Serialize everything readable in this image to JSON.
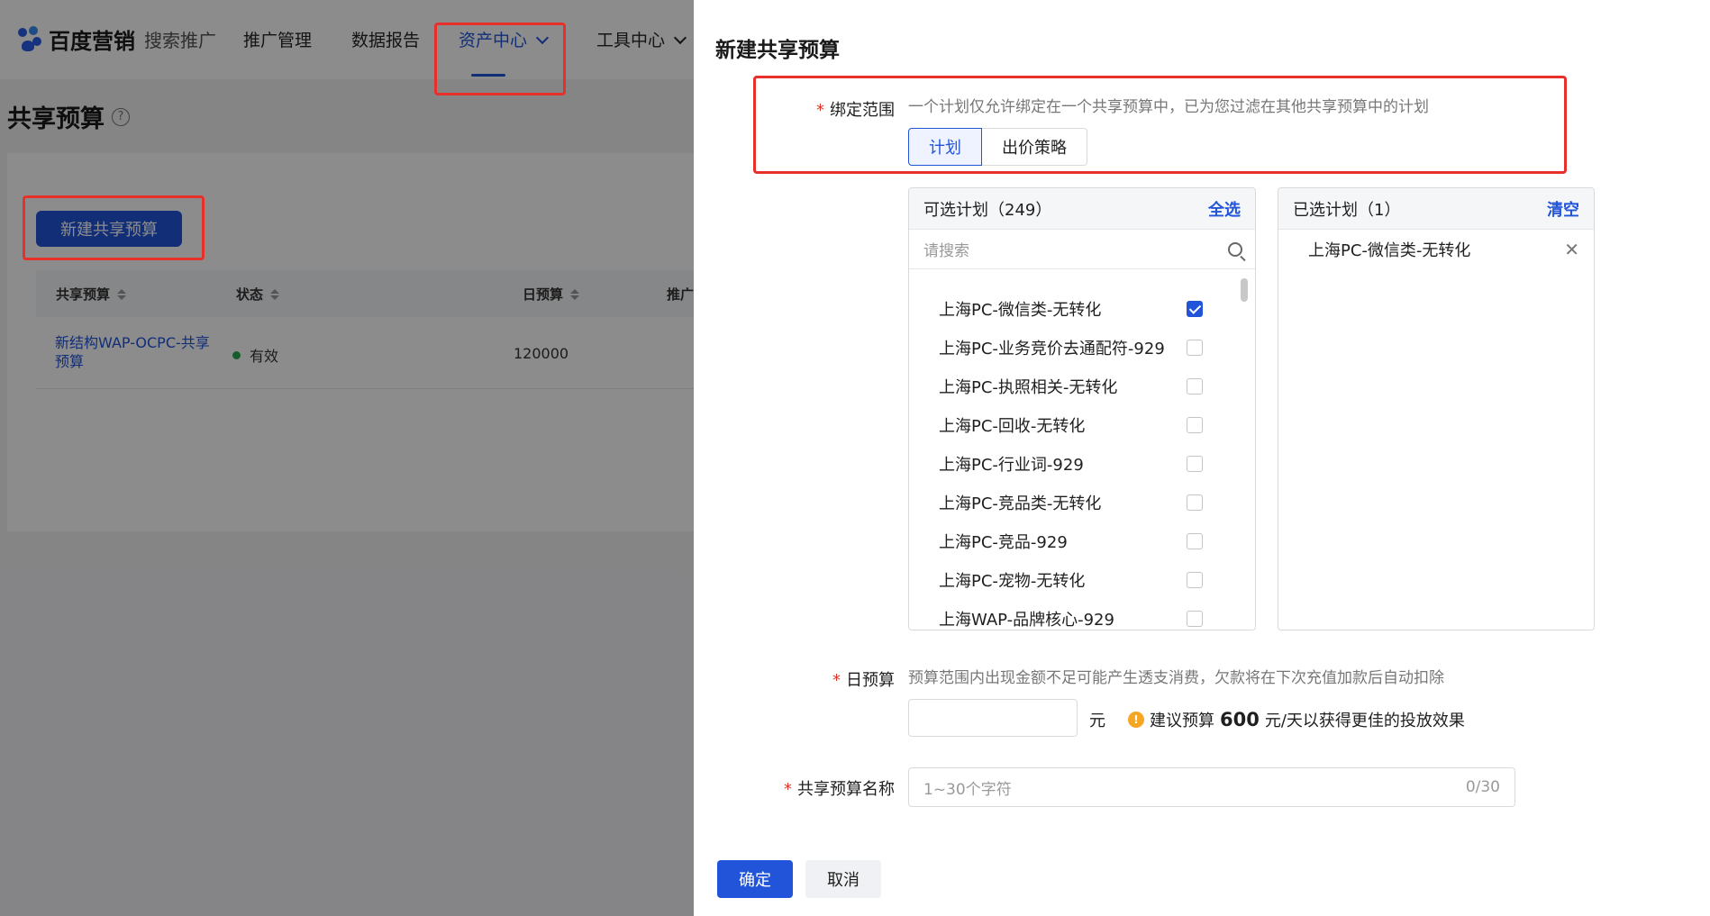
{
  "nav": {
    "brand": "百度营销",
    "brand_sub": "搜索推广",
    "items": [
      "推广管理",
      "数据报告",
      "资产中心",
      "工具中心"
    ]
  },
  "page": {
    "title": "共享预算",
    "new_button": "新建共享预算",
    "columns": [
      "共享预算",
      "状态",
      "日预算",
      "推广"
    ],
    "rows": [
      {
        "name": "新结构WAP-OCPC-共享预算",
        "status": "有效",
        "budget": "120000"
      }
    ]
  },
  "drawer": {
    "title": "新建共享预算",
    "scope": {
      "label": "绑定范围",
      "hint": "一个计划仅允许绑定在一个共享预算中，已为您过滤在其他共享预算中的计划",
      "tabs": [
        "计划",
        "出价策略"
      ]
    },
    "available": {
      "title": "可选计划（249）",
      "action": "全选",
      "search_placeholder": "请搜索",
      "items": [
        {
          "label": "上海PC-微信类-无转化",
          "checked": true
        },
        {
          "label": "上海PC-业务竞价去通配符-929",
          "checked": false
        },
        {
          "label": "上海PC-执照相关-无转化",
          "checked": false
        },
        {
          "label": "上海PC-回收-无转化",
          "checked": false
        },
        {
          "label": "上海PC-行业词-929",
          "checked": false
        },
        {
          "label": "上海PC-竞品类-无转化",
          "checked": false
        },
        {
          "label": "上海PC-竞品-929",
          "checked": false
        },
        {
          "label": "上海PC-宠物-无转化",
          "checked": false
        },
        {
          "label": "上海WAP-品牌核心-929",
          "checked": false
        }
      ]
    },
    "selected": {
      "title": "已选计划（1）",
      "action": "清空",
      "items": [
        "上海PC-微信类-无转化"
      ]
    },
    "daily_budget": {
      "label": "日预算",
      "hint": "预算范围内出现金额不足可能产生透支消费，欠款将在下次充值加款后自动扣除",
      "value": "",
      "unit": "元",
      "suggest_prefix": "建议预算",
      "suggest_amount": "600",
      "suggest_suffix": "元/天以获得更佳的投放效果"
    },
    "name_field": {
      "label": "共享预算名称",
      "placeholder": "1~30个字符",
      "counter": "0/30"
    },
    "confirm": "确定",
    "cancel": "取消"
  },
  "colors": {
    "primary": "#2154d9",
    "highlight": "#e8302a"
  }
}
